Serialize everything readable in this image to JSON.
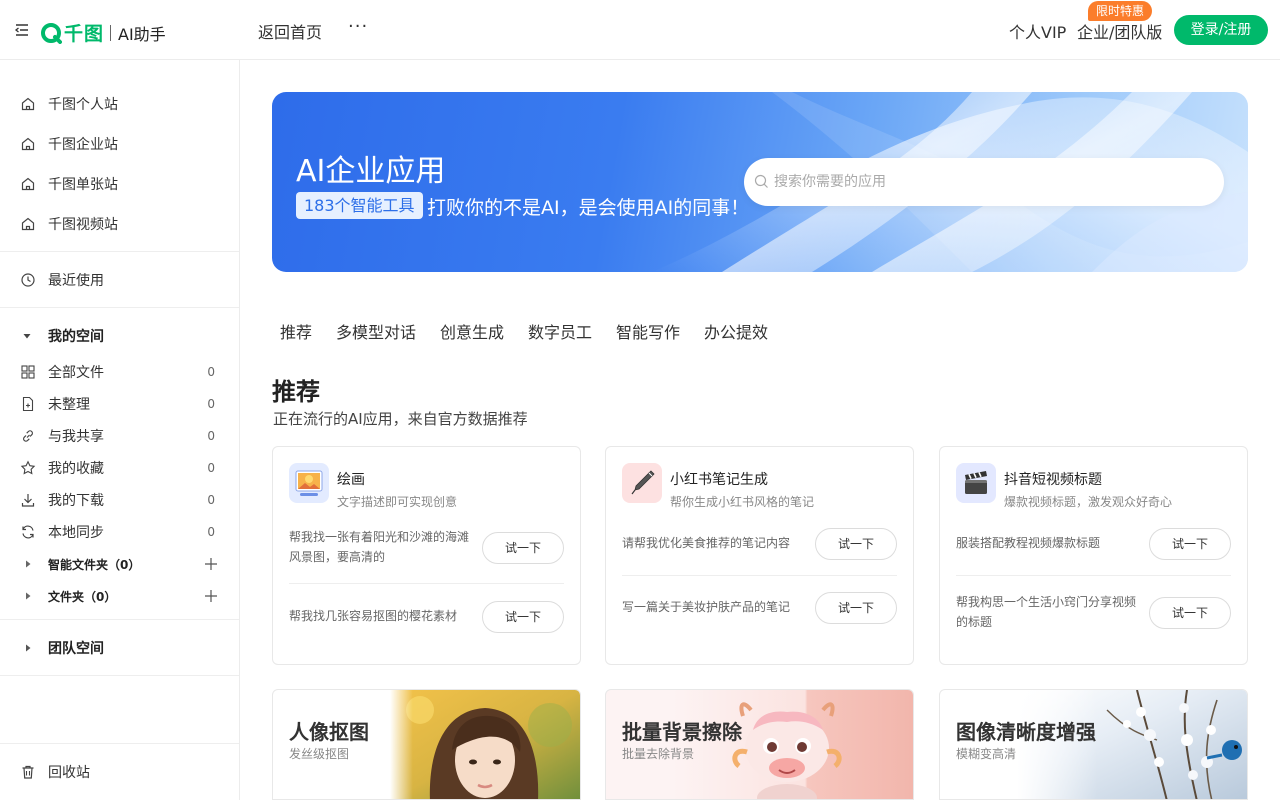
{
  "header": {
    "logo_text": "千图",
    "logo_sub": "AI助手",
    "home_link": "返回首页",
    "more": "···",
    "vip_link": "个人VIP",
    "enterprise_link": "企业/团队版",
    "promo_badge": "限时特惠",
    "login_button": "登录/注册"
  },
  "sidebar": {
    "sites": [
      "千图个人站",
      "千图企业站",
      "千图单张站",
      "千图视频站"
    ],
    "recent": "最近使用",
    "my_space": "我的空间",
    "files": [
      {
        "label": "全部文件",
        "count": "0"
      },
      {
        "label": "未整理",
        "count": "0"
      },
      {
        "label": "与我共享",
        "count": "0"
      },
      {
        "label": "我的收藏",
        "count": "0"
      },
      {
        "label": "我的下载",
        "count": "0"
      },
      {
        "label": "本地同步",
        "count": "0"
      }
    ],
    "smart_folder": "智能文件夹（0）",
    "folder": "文件夹（0）",
    "team_space": "团队空间",
    "trash": "回收站"
  },
  "banner": {
    "title": "AI企业应用",
    "tag": "183个智能工具",
    "slogan": "打败你的不是AI，是会使用AI的同事！",
    "search_placeholder": "搜索你需要的应用"
  },
  "tabs": [
    "推荐",
    "多模型对话",
    "创意生成",
    "数字员工",
    "智能写作",
    "办公提效"
  ],
  "section": {
    "title": "推荐",
    "subtitle": "正在流行的AI应用，来自官方数据推荐"
  },
  "cards": [
    {
      "title": "绘画",
      "desc": "文字描述即可实现创意",
      "prompts": [
        "帮我找一张有着阳光和沙滩的海滩风景图，要高清的",
        "帮我找几张容易抠图的樱花素材"
      ],
      "button": "试一下"
    },
    {
      "title": "小红书笔记生成",
      "desc": "帮你生成小红书风格的笔记",
      "prompts": [
        "请帮我优化美食推荐的笔记内容",
        "写一篇关于美妆护肤产品的笔记"
      ],
      "button": "试一下"
    },
    {
      "title": "抖音短视频标题",
      "desc": "爆款视频标题，激发观众好奇心",
      "prompts": [
        "服装搭配教程视频爆款标题",
        "帮我构思一个生活小窍门分享视频的标题"
      ],
      "button": "试一下"
    }
  ],
  "features": [
    {
      "title": "人像抠图",
      "subtitle": "发丝级抠图"
    },
    {
      "title": "批量背景擦除",
      "subtitle": "批量去除背景"
    },
    {
      "title": "图像清晰度增强",
      "subtitle": "模糊变高清"
    }
  ],
  "colors": {
    "brand_green": "#00b96b",
    "banner_blue": "#2e6cea",
    "promo_orange": "#fb7d2b"
  }
}
